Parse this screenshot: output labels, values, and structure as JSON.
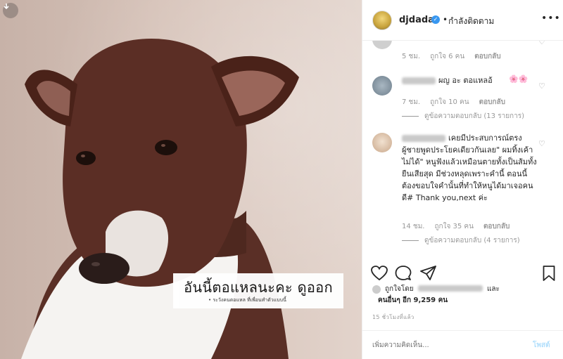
{
  "photo": {
    "caption_main": "อันนี้ตอแหลนะคะ ดูออก",
    "caption_sub": "• ระวังคนตอแหล ที่เพื่อนทำตัวแบบนี้",
    "arrow_icon": "chevron-down-icon"
  },
  "header": {
    "username": "djdada",
    "verified_icon": "verified-badge-icon",
    "separator": "•",
    "follow_status": "กำลังติดตาม",
    "more_icon": "more-horizontal-icon"
  },
  "comments": [
    {
      "time": "5 ชม.",
      "likes": "ถูกใจ 6 คน",
      "reply": "ตอบกลับ"
    },
    {
      "text": "ผญ อะ ตอแหลอ้",
      "time": "7 ชม.",
      "likes": "ถูกใจ 10 คน",
      "reply": "ตอบกลับ",
      "view_replies": "ดูข้อความตอบกลับ (13 รายการ)"
    },
    {
      "text": "เคยมีประสบการณ์ตรง ผู้ชายพูดประโยคเดียวกันเลย\" ผมทิ้งเค้าไม่ได้\" หนูฟังแล้วเหมือนตายทั้งเป็นส้มทั้งยืนเสียสุด มีช่วงหลุดเพราะคำนี้ ตอนนี้ต้องขอบใจคำนั้นที่ทำให้หนูได้มาเจอคนดี# Thank you,next ค่ะ",
      "time": "14 ชม.",
      "likes": "ถูกใจ 35 คน",
      "reply": "ตอบกลับ",
      "view_replies": "ดูข้อความตอบกลับ (4 รายการ)"
    }
  ],
  "actions": {
    "like_icon": "heart-icon",
    "comment_icon": "comment-icon",
    "share_icon": "share-icon",
    "save_icon": "bookmark-icon"
  },
  "likes": {
    "line1_prefix": "ถูกใจโดย",
    "line1_suffix": "และ",
    "line2_prefix": "คนอื่นๆ",
    "line2_count": "อีก 9,259 คน"
  },
  "time_ago": "15 ชั่วโมงที่แล้ว",
  "add_comment": {
    "placeholder": "เพิ่มความคิดเห็น...",
    "post_label": "โพสต์"
  }
}
